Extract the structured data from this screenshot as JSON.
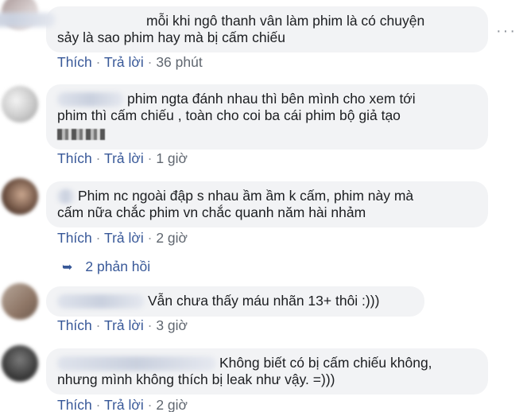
{
  "comments": [
    {
      "text_lines": [
        "mỗi khi ngô thanh vân làm phim là có chuyện",
        "sảy là sao phim hay mà bị cấm chiếu"
      ],
      "like": "Thích",
      "reply": "Trả lời",
      "dot": "·",
      "time": "36 phút"
    },
    {
      "text_lines": [
        "phim ngta đánh nhau thì bên mình cho xem tới",
        "phim thì cấm chiếu , toàn cho coi ba cái phim bộ giả tạo"
      ],
      "like": "Thích",
      "reply": "Trả lời",
      "dot": "·",
      "time": "1 giờ"
    },
    {
      "text_lines": [
        "Phim nc ngoài đập s nhau ầm ầm k cấm, phim này mà",
        "cấm nữa chắc phim vn chắc quanh năm hài nhảm"
      ],
      "like": "Thích",
      "reply": "Trả lời",
      "dot": "·",
      "time": "2 giờ"
    },
    {
      "text_lines": [
        "Vẫn chưa thấy máu nhãn 13+ thôi :)))"
      ],
      "like": "Thích",
      "reply": "Trả lời",
      "dot": "·",
      "time": "3 giờ"
    },
    {
      "text_lines": [
        "Không biết có bị cấm chiếu không,",
        "nhưng mình không thích bị leak như vậy. =)))"
      ],
      "like": "Thích",
      "reply": "Trả lời",
      "dot": "·",
      "time": "2 giờ"
    }
  ],
  "replies_link": "2 phản hồi",
  "more_options": "···",
  "colors": {
    "link": "#385898",
    "bubble": "#f2f3f5",
    "text": "#1c1e21"
  },
  "icons": [
    "more-options-icon",
    "reply-arrow-icon"
  ]
}
